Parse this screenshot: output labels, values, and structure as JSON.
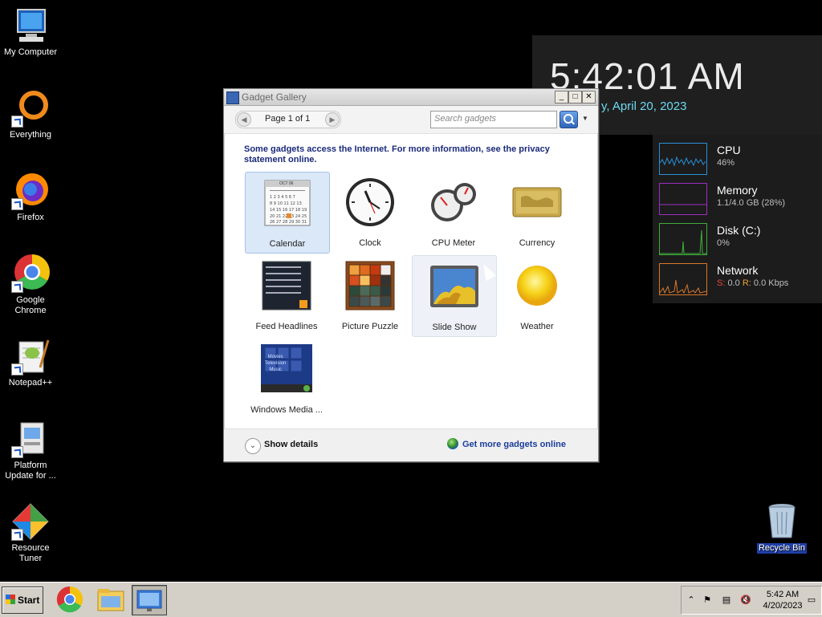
{
  "desktop": {
    "icons": [
      {
        "label": "My Computer"
      },
      {
        "label": "Everything"
      },
      {
        "label": "Firefox"
      },
      {
        "label": "Google Chrome"
      },
      {
        "label": "Notepad++"
      },
      {
        "label": "Platform Update for ..."
      },
      {
        "label": "Resource Tuner"
      },
      {
        "label": "Recycle Bin"
      }
    ]
  },
  "clock_gadget": {
    "time": "5:42:01 AM",
    "date": "y, April 20, 2023"
  },
  "perf_gadget": {
    "rows": [
      {
        "title": "CPU",
        "value": "46%",
        "color": "#2a8fd6"
      },
      {
        "title": "Memory",
        "value": "1.1/4.0 GB (28%)",
        "color": "#9b2fc0"
      },
      {
        "title": "Disk (C:)",
        "value": "0%",
        "color": "#3fae3a"
      },
      {
        "title": "Network",
        "value_s_label": "S:",
        "value_s": "0.0",
        "value_r_label": "R:",
        "value_r": "0.0 Kbps",
        "color": "#d7772a"
      }
    ]
  },
  "gadget_gallery": {
    "title": "Gadget Gallery",
    "page_label": "Page 1 of 1",
    "search_placeholder": "Search gadgets",
    "notice": "Some gadgets access the Internet.  For more information, see the privacy statement online.",
    "gadgets": [
      {
        "name": "Calendar",
        "state": "selected"
      },
      {
        "name": "Clock",
        "state": "normal"
      },
      {
        "name": "CPU Meter",
        "state": "normal"
      },
      {
        "name": "Currency",
        "state": "normal"
      },
      {
        "name": "Feed Headlines",
        "state": "normal"
      },
      {
        "name": "Picture Puzzle",
        "state": "normal"
      },
      {
        "name": "Slide Show",
        "state": "hover"
      },
      {
        "name": "Weather",
        "state": "normal"
      },
      {
        "name": "Windows Media ...",
        "state": "normal"
      }
    ],
    "show_details": "Show details",
    "get_more": "Get more gadgets online",
    "calendar_month": "OCT 06"
  },
  "media_center_thumb": {
    "lines": [
      "Movies",
      "Television",
      "Music"
    ]
  },
  "taskbar": {
    "start_label": "Start",
    "clock_time": "5:42 AM",
    "clock_date": "4/20/2023"
  }
}
